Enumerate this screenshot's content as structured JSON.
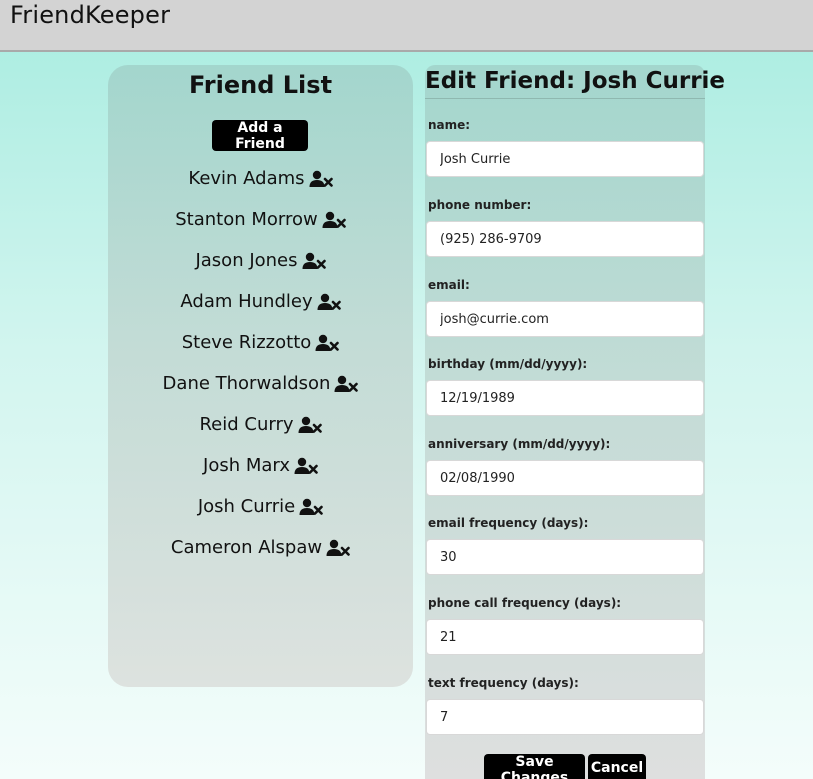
{
  "app": {
    "title": "FriendKeeper"
  },
  "friend_list": {
    "heading": "Friend List",
    "add_button": "Add a Friend",
    "friends": [
      {
        "name": "Kevin Adams"
      },
      {
        "name": "Stanton Morrow"
      },
      {
        "name": "Jason Jones"
      },
      {
        "name": "Adam Hundley"
      },
      {
        "name": "Steve Rizzotto"
      },
      {
        "name": "Dane Thorwaldson"
      },
      {
        "name": "Reid Curry"
      },
      {
        "name": "Josh Marx"
      },
      {
        "name": "Josh Currie"
      },
      {
        "name": "Cameron Alspaw"
      }
    ],
    "remove_icon": "user-remove-icon"
  },
  "edit_form": {
    "title": "Edit Friend: Josh Currie",
    "fields": [
      {
        "label": "name:",
        "value": "Josh Currie"
      },
      {
        "label": "phone number:",
        "value": "(925) 286-9709"
      },
      {
        "label": "email:",
        "value": "josh@currie.com"
      },
      {
        "label": "birthday (mm/dd/yyyy):",
        "value": "12/19/1989"
      },
      {
        "label": "anniversary (mm/dd/yyyy):",
        "value": "02/08/1990"
      },
      {
        "label": "email frequency (days):",
        "value": "30"
      },
      {
        "label": "phone call frequency (days):",
        "value": "21"
      },
      {
        "label": "text frequency (days):",
        "value": "7"
      }
    ],
    "save_button": "Save Changes",
    "cancel_button": "Cancel"
  },
  "colors": {
    "topbar": "#d3d3d3",
    "button": "#000000",
    "panel": "#a3d6cd"
  }
}
